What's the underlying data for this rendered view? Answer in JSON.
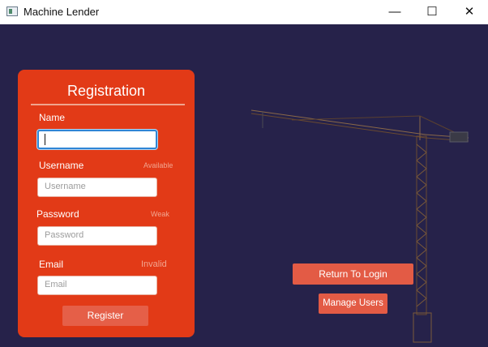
{
  "window": {
    "title": "Machine Lender",
    "controls": {
      "minimize": "—",
      "maximize": "☐",
      "close": "✕"
    }
  },
  "registration": {
    "title": "Registration",
    "name": {
      "label": "Name",
      "value": "",
      "placeholder": ""
    },
    "username": {
      "label": "Username",
      "status": "Available",
      "placeholder": "Username"
    },
    "password": {
      "label": "Password",
      "status": "Weak",
      "placeholder": "Password"
    },
    "email": {
      "label": "Email",
      "status": "Invalid",
      "placeholder": "Email"
    },
    "register_label": "Register"
  },
  "actions": {
    "return_to_login_label": "Return To Login",
    "manage_users_label": "Manage Users"
  },
  "colors": {
    "background": "#26224a",
    "card": "#e23a17",
    "button": "#e35b45"
  }
}
